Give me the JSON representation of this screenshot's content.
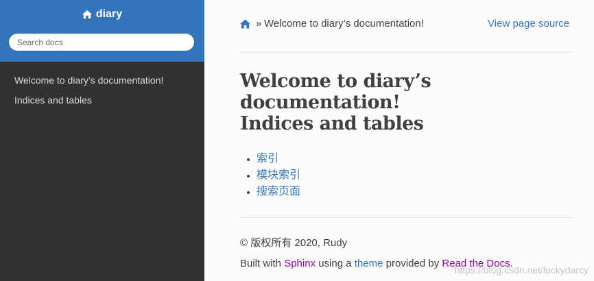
{
  "sidebar": {
    "brand": "diary",
    "search_placeholder": "Search docs",
    "items": [
      {
        "label": "Welcome to diary’s documentation!"
      },
      {
        "label": "Indices and tables"
      }
    ]
  },
  "breadcrumbs": {
    "separator": "»",
    "current": "Welcome to diary’s documentation!",
    "view_source": "View page source"
  },
  "main": {
    "title": "Welcome to diary’s documentation!",
    "section_title": "Indices and tables",
    "links": [
      "索引",
      "模块索引",
      "搜索页面"
    ]
  },
  "footer": {
    "copyright": "© 版权所有 2020, Rudy",
    "built_prefix": "Built with ",
    "sphinx": "Sphinx",
    "using_a": " using a ",
    "theme": "theme",
    "provided_by": " provided by ",
    "rtd": "Read the Docs",
    "suffix": "."
  },
  "watermark": "https://blog.csdn.net/luckydarcy",
  "colors": {
    "sidebar_top": "#3474bd",
    "sidebar_bg": "#343131",
    "link": "#3474bd",
    "link_visited": "#9b00b9"
  },
  "icons": [
    "home-icon"
  ]
}
